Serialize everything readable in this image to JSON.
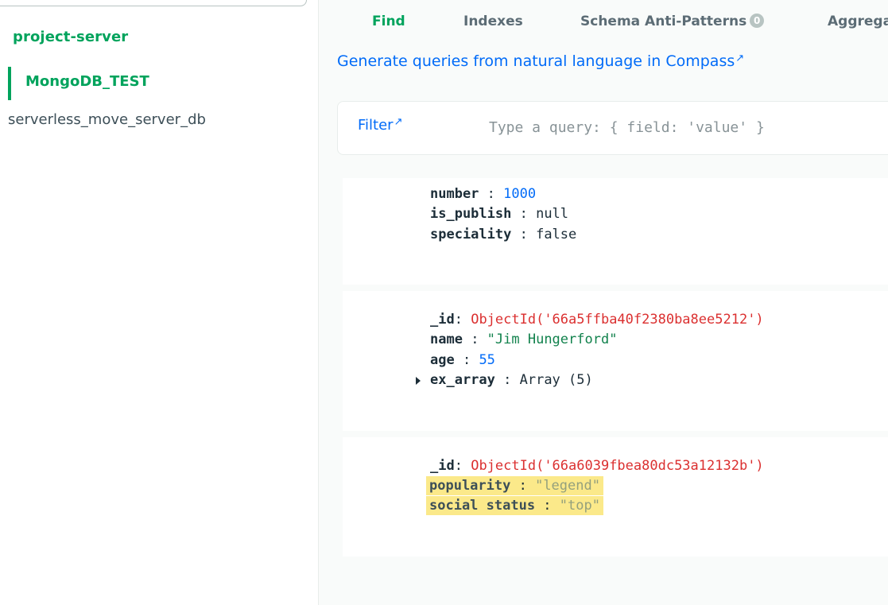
{
  "sidebar": {
    "project": "project-server",
    "active_db": "MongoDB_TEST",
    "other_db": "serverless_move_server_db"
  },
  "tabs": [
    {
      "label": "Find",
      "active": true
    },
    {
      "label": "Indexes",
      "active": false
    },
    {
      "label": "Schema Anti-Patterns",
      "badge": "0",
      "active": false
    },
    {
      "label": "Aggrega",
      "active": false
    }
  ],
  "nl_link": "Generate queries from natural language in Compass",
  "filter": {
    "label": "Filter",
    "placeholder": "Type a query: { field: 'value' }"
  },
  "documents": [
    {
      "fields": [
        {
          "key": "number",
          "value": "1000",
          "type": "number"
        },
        {
          "key": "is_publish",
          "value": "null",
          "type": "plain"
        },
        {
          "key": "speciality",
          "value": "false",
          "type": "plain"
        }
      ]
    },
    {
      "fields": [
        {
          "key": "_id",
          "value": "ObjectId('66a5ffba40f2380ba8ee5212')",
          "type": "oid"
        },
        {
          "key": "name",
          "value": "\"Jim Hungerford\"",
          "type": "string"
        },
        {
          "key": "age",
          "value": "55",
          "type": "number"
        },
        {
          "key": "ex_array",
          "value": "Array (5)",
          "type": "plain",
          "expandable": true
        }
      ]
    },
    {
      "fields": [
        {
          "key": "_id",
          "value": "ObjectId('66a6039fbea80dc53a12132b')",
          "type": "oid"
        },
        {
          "key": "popularity",
          "value": "\"legend\"",
          "type": "string",
          "highlighted": true
        },
        {
          "key": "social status",
          "value": "\"top\"",
          "type": "string",
          "highlighted": true
        }
      ]
    }
  ],
  "colors": {
    "accent_green": "#00a35c",
    "link_blue": "#016bf8",
    "highlight": "#fbe98a",
    "objectid_red": "#db3030"
  }
}
